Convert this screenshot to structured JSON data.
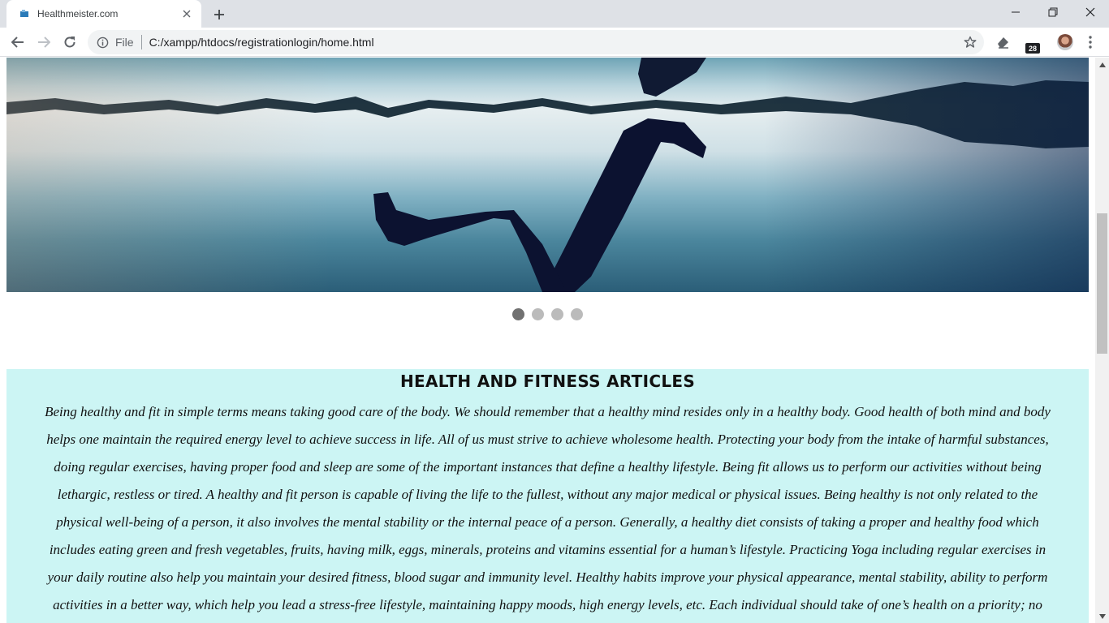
{
  "browser": {
    "tab_title": "Healthmeister.com",
    "url_scheme": "File",
    "url": "C:/xampp/htdocs/registrationlogin/home.html",
    "extension_badge": "28"
  },
  "slider": {
    "dot_count": 4,
    "active_index": 0
  },
  "articles": {
    "heading": "HEALTH AND FITNESS ARTICLES",
    "body": "Being healthy and fit in simple terms means taking good care of the body. We should remember that a healthy mind resides only in a healthy body. Good health of both mind and body helps one maintain the required energy level to achieve success in life. All of us must strive to achieve wholesome health. Protecting your body from the intake of harmful substances, doing regular exercises, having proper food and sleep are some of the important instances that define a healthy lifestyle. Being fit allows us to perform our activities without being lethargic, restless or tired. A healthy and fit person is capable of living the life to the fullest, without any major medical or physical issues. Being healthy is not only related to the physical well-being of a person, it also involves the mental stability or the internal peace of a person. Generally, a healthy diet consists of taking a proper and healthy food which includes eating green and fresh vegetables, fruits, having milk, eggs, minerals, proteins and vitamins essential for a human’s lifestyle. Practicing Yoga including regular exercises in your daily routine also help you maintain your desired fitness, blood sugar and immunity level. Healthy habits improve your physical appearance, mental stability, ability to perform activities in a better way, which help you lead a stress-free lifestyle, maintaining happy moods, high energy levels, etc. Each individual should take of one’s health on a priority; no single day should be skipped for making efforts on maintaining physical and mental fitness. Being happy is"
  }
}
